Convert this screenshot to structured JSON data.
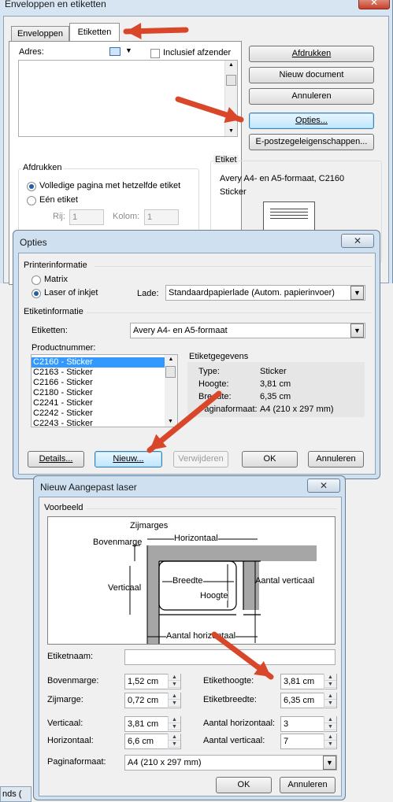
{
  "env": {
    "title": "Enveloppen en etiketten",
    "tabs": [
      "Enveloppen",
      "Etiketten"
    ],
    "adres_label": "Adres:",
    "inclusief_label": "Inclusief afzender",
    "buttons": [
      "Afdrukken",
      "Nieuw document",
      "Annuleren",
      "Opties...",
      "E-postzegeleigenschappen..."
    ],
    "afdrukken_group": "Afdrukken",
    "radio_full": "Volledige pagina met hetzelfde etiket",
    "radio_one": "Eén etiket",
    "rij_label": "Rij:",
    "rij_value": "1",
    "kolom_label": "Kolom:",
    "kolom_value": "1",
    "etiket_group": "Etiket",
    "etiket_line1": "Avery A4- en A5-formaat, C2160",
    "etiket_line2": "Sticker"
  },
  "opties": {
    "title": "Opties",
    "printerinfo": "Printerinformatie",
    "matrix": "Matrix",
    "laser": "Laser of inkjet",
    "lade_label": "Lade:",
    "lade_value": "Standaardpapierlade (Autom. papierinvoer)",
    "etiketinfo": "Etiketinformatie",
    "etiketten_label": "Etiketten:",
    "etiketten_value": "Avery A4- en A5-formaat",
    "productnummer_label": "Productnummer:",
    "products": [
      "C2160 - Sticker",
      "C2163 - Sticker",
      "C2166 - Sticker",
      "C2180 - Sticker",
      "C2241 - Sticker",
      "C2242 - Sticker",
      "C2243 - Sticker"
    ],
    "gegevens_title": "Etiketgegevens",
    "gegevens": [
      {
        "k": "Type:",
        "v": "Sticker"
      },
      {
        "k": "Hoogte:",
        "v": "3,81 cm"
      },
      {
        "k": "Breedte:",
        "v": "6,35 cm"
      },
      {
        "k": "Paginaformaat:",
        "v": "A4 (210 x 297 mm)"
      }
    ],
    "buttons": [
      "Details...",
      "Nieuw...",
      "Verwijderen",
      "OK",
      "Annuleren"
    ]
  },
  "nieuw": {
    "title": "Nieuw Aangepast laser",
    "voorbeeld": "Voorbeeld",
    "diagram": {
      "zijmarges": "Zijmarges",
      "bovenmarge": "Bovenmarge",
      "horizontaal": "Horizontaal",
      "verticaal": "Verticaal",
      "breedte": "Breedte",
      "hoogte": "Hoogte",
      "aantal_verticaal": "Aantal verticaal",
      "aantal_horizontaal": "Aantal horizontaal"
    },
    "etiketnaam_label": "Etiketnaam:",
    "etiketnaam_value": "",
    "left_fields": [
      {
        "label": "Bovenmarge:",
        "value": "1,52 cm"
      },
      {
        "label": "Zijmarge:",
        "value": "0,72 cm"
      },
      {
        "label": "Verticaal:",
        "value": "3,81 cm"
      },
      {
        "label": "Horizontaal:",
        "value": "6,6 cm"
      }
    ],
    "right_fields": [
      {
        "label": "Etikethoogte:",
        "value": "3,81 cm"
      },
      {
        "label": "Etiketbreedte:",
        "value": "6,35 cm"
      },
      {
        "label": "Aantal horizontaal:",
        "value": "3"
      },
      {
        "label": "Aantal verticaal:",
        "value": "7"
      }
    ],
    "paginaformaat_label": "Paginaformaat:",
    "paginaformaat_value": "A4 (210 x 297 mm)",
    "ok": "OK",
    "annuleren": "Annuleren"
  },
  "taskbar_text": "nds (",
  "arrow_color": "#d9472b"
}
